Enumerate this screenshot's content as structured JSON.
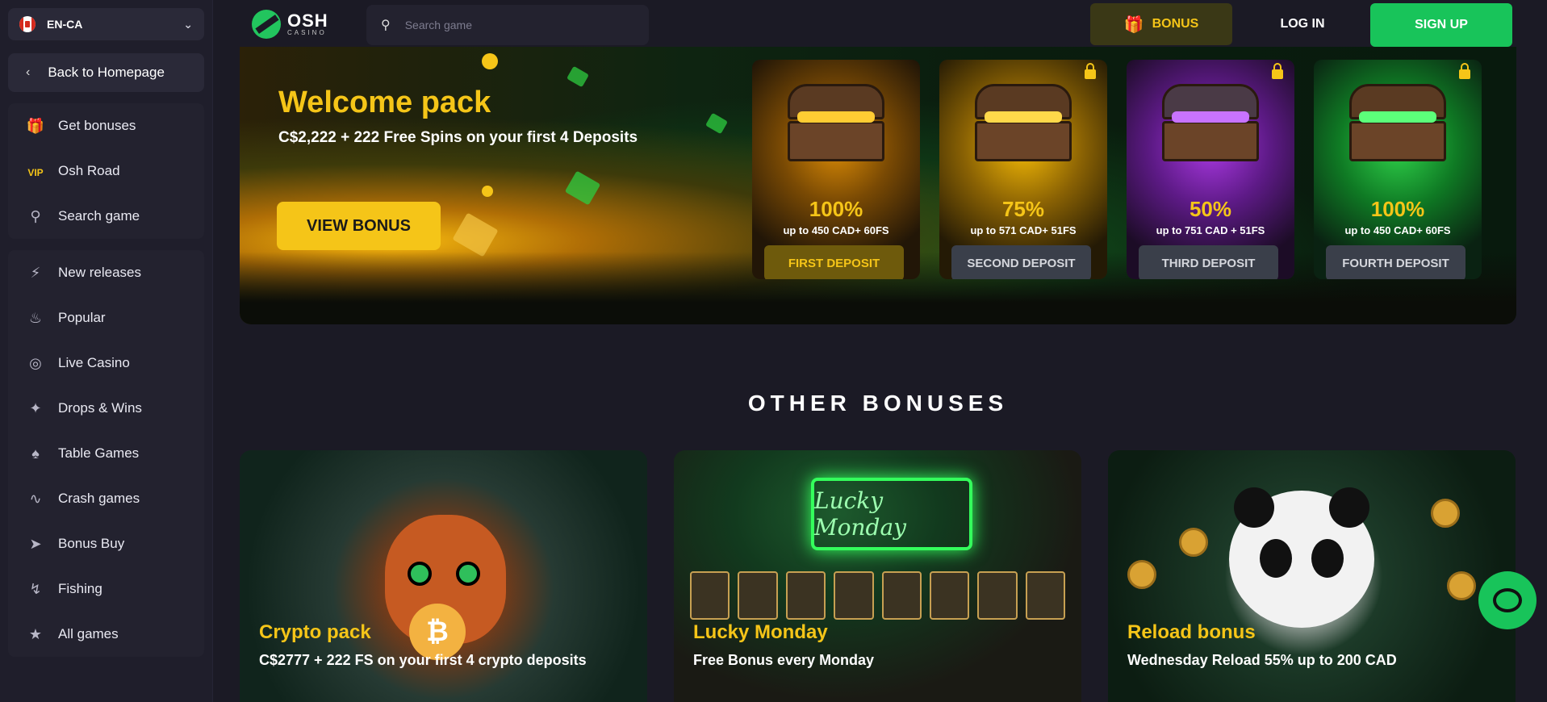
{
  "sidebar": {
    "language": "EN-CA",
    "back_label": "Back to Homepage",
    "group1": [
      {
        "label": "Get bonuses",
        "icon": "gift-icon"
      },
      {
        "label": "Osh Road",
        "icon": "vip-icon",
        "badge": "VIP"
      },
      {
        "label": "Search game",
        "icon": "search-icon"
      }
    ],
    "group2": [
      {
        "label": "New releases",
        "icon": "lightning-icon"
      },
      {
        "label": "Popular",
        "icon": "fire-icon"
      },
      {
        "label": "Live Casino",
        "icon": "chip-icon"
      },
      {
        "label": "Drops & Wins",
        "icon": "drops-icon"
      },
      {
        "label": "Table Games",
        "icon": "cards-icon"
      },
      {
        "label": "Crash games",
        "icon": "pulse-icon"
      },
      {
        "label": "Bonus Buy",
        "icon": "rocket-icon"
      },
      {
        "label": "Fishing",
        "icon": "fishing-icon"
      },
      {
        "label": "All games",
        "icon": "grid-icon"
      }
    ]
  },
  "header": {
    "logo_big": "OSH",
    "logo_small": "CASINO",
    "search_placeholder": "Search game",
    "bonus_label": "BONUS",
    "login_label": "LOG IN",
    "signup_label": "SIGN UP"
  },
  "welcome": {
    "title": "Welcome pack",
    "subtitle": "C$2,222 + 222 Free Spins on your first 4 Deposits",
    "button": "VIEW BONUS",
    "deposits": [
      {
        "percent": "100%",
        "desc": "up to 450 CAD+ 60FS",
        "button": "FIRST DEPOSIT",
        "locked": false,
        "theme": "#f5c518"
      },
      {
        "percent": "75%",
        "desc": "up to 571 CAD+ 51FS",
        "button": "SECOND DEPOSIT",
        "locked": true,
        "theme": "#e0a10a"
      },
      {
        "percent": "50%",
        "desc": "up to 751 CAD + 51FS",
        "button": "THIRD DEPOSIT",
        "locked": true,
        "theme": "#9b2cd6"
      },
      {
        "percent": "100%",
        "desc": "up to 450 CAD+ 60FS",
        "button": "FOURTH DEPOSIT",
        "locked": true,
        "theme": "#2ecc40"
      }
    ]
  },
  "other": {
    "title": "OTHER BONUSES",
    "promos": [
      {
        "title": "Crypto pack",
        "subtitle": "C$2777 + 222 FS on your first 4 crypto deposits"
      },
      {
        "title": "Lucky Monday",
        "subtitle": "Free Bonus every Monday",
        "sign": "Lucky Monday"
      },
      {
        "title": "Reload bonus",
        "subtitle": "Wednesday Reload 55% up to 200 CAD"
      }
    ]
  },
  "colors": {
    "accent_green": "#18c45a",
    "accent_yellow": "#f5c518",
    "background": "#1b1a25"
  }
}
